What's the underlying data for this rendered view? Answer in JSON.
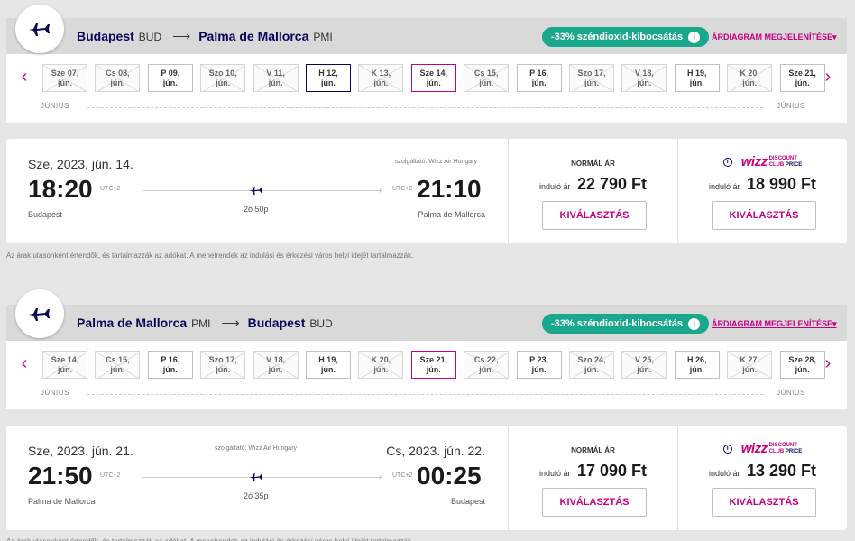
{
  "colors": {
    "brand_navy": "#06065a",
    "brand_magenta": "#c6007e",
    "eco_green": "#1aa88c"
  },
  "icons": {
    "plane": "plane-icon",
    "prev": "chevron-left-icon",
    "next": "chevron-right-icon",
    "info": "info-icon"
  },
  "outbound": {
    "origin": "Budapest",
    "origin_code": "BUD",
    "dest": "Palma de Mallorca",
    "dest_code": "PMI",
    "arrow": "⟶",
    "eco": "-33% széndioxid-kibocsátás",
    "chart_link": "ÁRDIAGRAM MEGJELENÍTÉSE",
    "dates": [
      {
        "day": "Sze 07,",
        "mon": "jún.",
        "state": "na"
      },
      {
        "day": "Cs 08,",
        "mon": "jún.",
        "state": "na"
      },
      {
        "day": "P 09,",
        "mon": "jún.",
        "state": "avail"
      },
      {
        "day": "Szo 10,",
        "mon": "jún.",
        "state": "na"
      },
      {
        "day": "V 11,",
        "mon": "jún.",
        "state": "na"
      },
      {
        "day": "H 12,",
        "mon": "jún.",
        "state": "sel"
      },
      {
        "day": "K 13,",
        "mon": "jún.",
        "state": "na"
      },
      {
        "day": "Sze 14,",
        "mon": "jún.",
        "state": "cur"
      },
      {
        "day": "Cs 15,",
        "mon": "jún.",
        "state": "na"
      },
      {
        "day": "P 16,",
        "mon": "jún.",
        "state": "avail"
      },
      {
        "day": "Szo 17,",
        "mon": "jún.",
        "state": "na"
      },
      {
        "day": "V 18,",
        "mon": "jún.",
        "state": "na"
      },
      {
        "day": "H 19,",
        "mon": "jún.",
        "state": "avail"
      },
      {
        "day": "K 20,",
        "mon": "jún.",
        "state": "na"
      },
      {
        "day": "Sze 21,",
        "mon": "jún.",
        "state": "avail"
      }
    ],
    "month_left": "JÚNIUS",
    "month_right": "JÚNIUS",
    "dep_date": "Sze, 2023. jún. 14.",
    "arr_date": "",
    "operator": "szolgáltató: Wizz Air Hungary",
    "dep_time": "18:20",
    "arr_time": "21:10",
    "utc_dep": "UTC+2",
    "utc_arr": "UTC+2",
    "duration": "2ó 50p",
    "dep_city": "Budapest",
    "arr_city": "Palma de Mallorca",
    "normal_title": "NORMÁL ÁR",
    "from_label": "induló ár",
    "normal_price": "22 790 Ft",
    "wdc_price": "18 990 Ft",
    "select_label": "KIVÁLASZTÁS"
  },
  "inbound": {
    "origin": "Palma de Mallorca",
    "origin_code": "PMI",
    "dest": "Budapest",
    "dest_code": "BUD",
    "arrow": "⟶",
    "eco": "-33% széndioxid-kibocsátás",
    "chart_link": "ÁRDIAGRAM MEGJELENÍTÉSE",
    "dates": [
      {
        "day": "Sze 14,",
        "mon": "jún.",
        "state": "na"
      },
      {
        "day": "Cs 15,",
        "mon": "jún.",
        "state": "na"
      },
      {
        "day": "P 16,",
        "mon": "jún.",
        "state": "avail"
      },
      {
        "day": "Szo 17,",
        "mon": "jún.",
        "state": "na"
      },
      {
        "day": "V 18,",
        "mon": "jún.",
        "state": "na"
      },
      {
        "day": "H 19,",
        "mon": "jún.",
        "state": "avail"
      },
      {
        "day": "K 20,",
        "mon": "jún.",
        "state": "na"
      },
      {
        "day": "Sze 21,",
        "mon": "jún.",
        "state": "cur"
      },
      {
        "day": "Cs 22,",
        "mon": "jún.",
        "state": "na"
      },
      {
        "day": "P 23,",
        "mon": "jún.",
        "state": "avail"
      },
      {
        "day": "Szo 24,",
        "mon": "jún.",
        "state": "na"
      },
      {
        "day": "V 25,",
        "mon": "jún.",
        "state": "na"
      },
      {
        "day": "H 26,",
        "mon": "jún.",
        "state": "avail"
      },
      {
        "day": "K 27,",
        "mon": "jún.",
        "state": "na"
      },
      {
        "day": "Sze 28,",
        "mon": "jún.",
        "state": "avail"
      }
    ],
    "month_left": "JÚNIUS",
    "month_right": "JÚNIUS",
    "dep_date": "Sze, 2023. jún. 21.",
    "arr_date": "Cs, 2023. jún. 22.",
    "operator": "szolgáltató: Wizz Air Hungary",
    "dep_time": "21:50",
    "arr_time": "00:25",
    "utc_dep": "UTC+2",
    "utc_arr": "UTC+2",
    "duration": "2ó 35p",
    "dep_city": "Palma de Mallorca",
    "arr_city": "Budapest",
    "normal_title": "NORMÁL ÁR",
    "from_label": "induló ár",
    "normal_price": "17 090 Ft",
    "wdc_price": "13 290 Ft",
    "select_label": "KIVÁLASZTÁS"
  },
  "wdc": {
    "logo": "wizz",
    "line1": "DISCOUNT",
    "line2": "CLUB",
    "line3": "PRICE"
  },
  "disclaimer": "Az árak utasonként értendők, és tartalmazzák az adókat. A menetrendek az indulási és érkezési város helyi idejét tartalmazzák."
}
